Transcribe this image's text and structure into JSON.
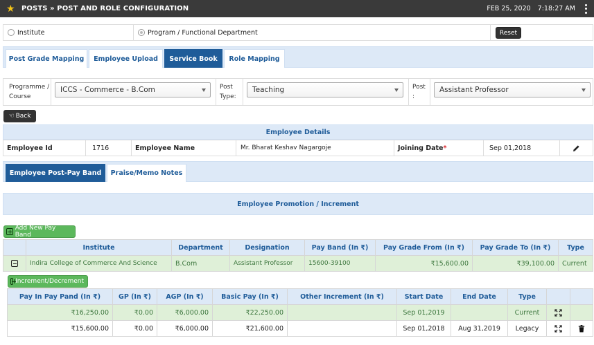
{
  "header": {
    "title": "POSTS » POST AND ROLE CONFIGURATION",
    "date": "FEB 25, 2020",
    "time": "7:18:27 AM"
  },
  "radio": {
    "institute_label": "Institute",
    "program_label": "Program / Functional Department",
    "reset_label": "Reset"
  },
  "tabs": [
    {
      "label": "Post Grade Mapping"
    },
    {
      "label": "Employee Upload"
    },
    {
      "label": "Service Book"
    },
    {
      "label": "Role Mapping"
    }
  ],
  "filters": {
    "programme_label_1": "Programme /",
    "programme_label_2": "Course",
    "programme_value": "ICCS - Commerce - B.Com",
    "post_type_label_1": "Post",
    "post_type_label_2": "Type:",
    "post_type_value": "Teaching",
    "post_label_1": "Post",
    "post_label_2": ":",
    "post_value": "Assistant Professor"
  },
  "back_label": "Back",
  "employee_details": {
    "heading": "Employee Details",
    "id_label": "Employee Id",
    "id_value": "1716",
    "name_label": "Employee Name",
    "name_value": "Mr. Bharat Keshav Nagargoje",
    "joining_label": "Joining Date",
    "joining_required": "*",
    "joining_value": "Sep 01,2018"
  },
  "subtabs": [
    {
      "label": "Employee Post-Pay Band"
    },
    {
      "label": "Praise/Memo Notes"
    }
  ],
  "promotion": {
    "heading": "Employee Promotion / Increment",
    "add_button": "Add New Pay Band",
    "columns": [
      "Institute",
      "Department",
      "Designation",
      "Pay Band (In ₹)",
      "Pay Grade From (In ₹)",
      "Pay Grade To (In ₹)",
      "Type"
    ],
    "row": {
      "institute": "Indira College of Commerce And Science",
      "department": "B.Com",
      "designation": "Assistant Professor",
      "pay_band": "15600-39100",
      "grade_from": "₹15,600.00",
      "grade_to": "₹39,100.00",
      "type": "Current"
    }
  },
  "increment": {
    "button": "Increment/Decrement",
    "columns": [
      "Pay In Pay Pand (In ₹)",
      "GP (In ₹)",
      "AGP (In ₹)",
      "Basic Pay (In ₹)",
      "Other Increment (In ₹)",
      "Start Date",
      "End Date",
      "Type"
    ],
    "rows": [
      {
        "pay": "₹16,250.00",
        "gp": "₹0.00",
        "agp": "₹6,000.00",
        "basic": "₹22,250.00",
        "other": "",
        "start": "Sep 01,2019",
        "end": "",
        "type": "Current"
      },
      {
        "pay": "₹15,600.00",
        "gp": "₹0.00",
        "agp": "₹6,000.00",
        "basic": "₹21,600.00",
        "other": "",
        "start": "Sep 01,2018",
        "end": "Aug 31,2019",
        "type": "Legacy"
      }
    ]
  }
}
